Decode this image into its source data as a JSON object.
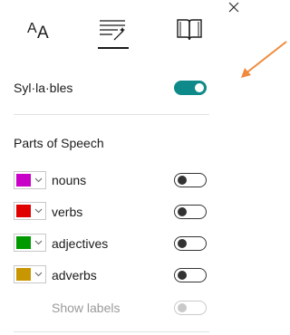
{
  "tabs": {
    "text_options_label": "AA",
    "icons": [
      "text-size-icon",
      "grammar-tools-icon",
      "reading-preferences-icon"
    ]
  },
  "syllables": {
    "label": "Syl·la·bles",
    "enabled": true
  },
  "parts_of_speech": {
    "heading": "Parts of Speech",
    "items": [
      {
        "label": "nouns",
        "color": "#c800c8",
        "enabled": false
      },
      {
        "label": "verbs",
        "color": "#e00000",
        "enabled": false
      },
      {
        "label": "adjectives",
        "color": "#009a00",
        "enabled": false
      },
      {
        "label": "adverbs",
        "color": "#c89600",
        "enabled": false
      }
    ],
    "show_labels": {
      "label": "Show labels",
      "enabled": false,
      "disabled": true
    }
  },
  "colors": {
    "accent": "#0f8a8a",
    "annotation_arrow": "#f08a3c"
  }
}
